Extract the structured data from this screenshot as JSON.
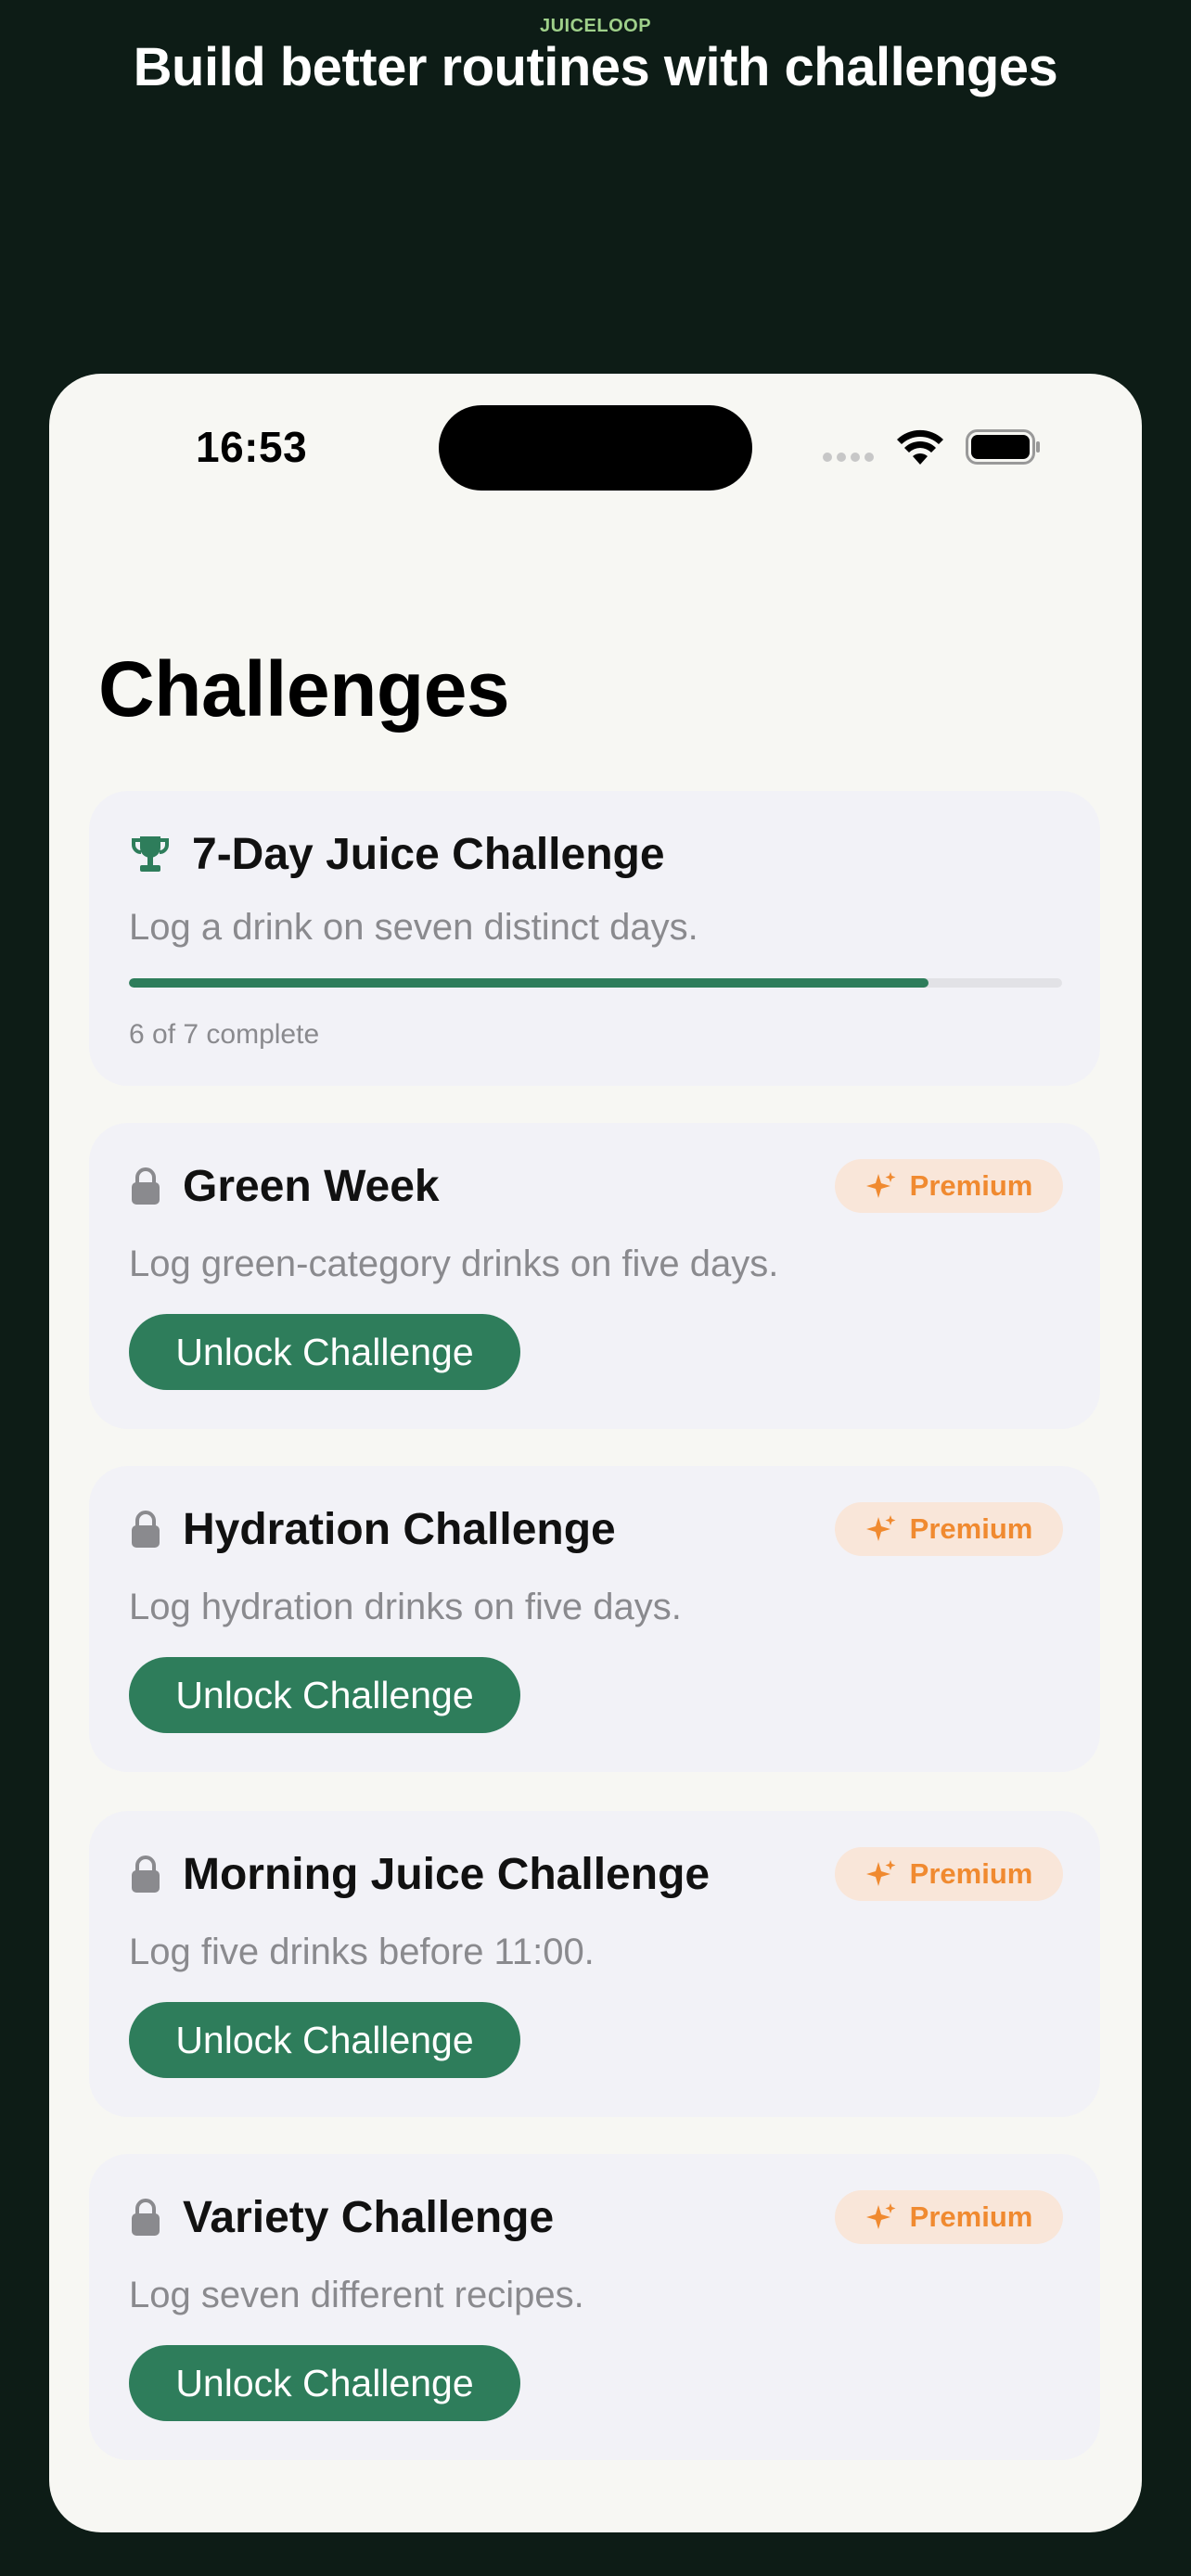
{
  "marketing": {
    "brand": "JUICELOOP",
    "headline": "Build better routines with challenges"
  },
  "status_bar": {
    "time": "16:53"
  },
  "page": {
    "title": "Challenges"
  },
  "featured_challenge": {
    "title": "7-Day Juice Challenge",
    "description": "Log a drink on seven distinct days.",
    "progress_fraction": 0.857,
    "progress_label": "6 of 7 complete",
    "icon": "trophy-icon"
  },
  "locked_challenges": [
    {
      "title": "Green Week",
      "description": "Log green-category drinks on five days.",
      "badge": "Premium",
      "button": "Unlock Challenge"
    },
    {
      "title": "Hydration Challenge",
      "description": "Log hydration drinks on five days.",
      "badge": "Premium",
      "button": "Unlock Challenge"
    },
    {
      "title": "Morning Juice Challenge",
      "description": "Log five drinks before 11:00.",
      "badge": "Premium",
      "button": "Unlock Challenge"
    },
    {
      "title": "Variety Challenge",
      "description": "Log seven different recipes.",
      "badge": "Premium",
      "button": "Unlock Challenge"
    }
  ],
  "colors": {
    "background": "#0d1c16",
    "accent_green": "#2e7d5b",
    "premium_orange": "#f08a30",
    "premium_bg": "#f9e6d9",
    "card_bg": "#f2f2f7"
  }
}
